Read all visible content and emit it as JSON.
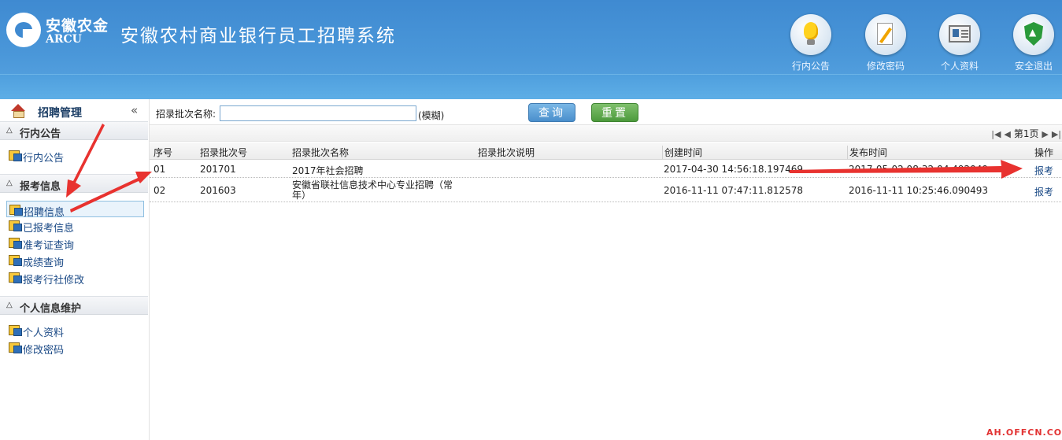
{
  "header": {
    "logo_cn": "安徽农金",
    "logo_en": "ARCU",
    "system_title": "安徽农村商业银行员工招聘系统",
    "nav": [
      {
        "label": "行内公告",
        "icon": "lightbulb-icon"
      },
      {
        "label": "修改密码",
        "icon": "notepad-pencil-icon"
      },
      {
        "label": "个人资料",
        "icon": "id-card-icon"
      },
      {
        "label": "安全退出",
        "icon": "shield-exit-icon"
      }
    ]
  },
  "sidebar": {
    "title": "招聘管理",
    "collapse_glyph": "«",
    "sections": [
      {
        "title": "行内公告",
        "items": [
          "行内公告"
        ]
      },
      {
        "title": "报考信息",
        "items": [
          "招聘信息",
          "已报考信息",
          "准考证查询",
          "成绩查询",
          "报考行社修改"
        ]
      },
      {
        "title": "个人信息维护",
        "items": [
          "个人资料",
          "修改密码"
        ]
      }
    ],
    "active_item": "招聘信息"
  },
  "search": {
    "label": "招录批次名称:",
    "value": "",
    "hint": "(模糊)",
    "query_button": "查询",
    "reset_button": "重置"
  },
  "pager": {
    "page_text": "第1页"
  },
  "table": {
    "headers": [
      "序号",
      "招录批次号",
      "招录批次名称",
      "招录批次说明",
      "创建时间",
      "发布时间",
      "操作"
    ],
    "rows": [
      [
        "01",
        "201701",
        "2017年社会招聘",
        "",
        "2017-04-30 14:56:18.197469",
        "2017-05-02 08:32:04.492049",
        "报考"
      ],
      [
        "02",
        "201603",
        "安徽省联社信息技术中心专业招聘（常年）",
        "",
        "2016-11-11 07:47:11.812578",
        "2016-11-11 10:25:46.090493",
        "报考"
      ]
    ]
  },
  "watermark": "AH.OFFCN.COM",
  "colors": {
    "header_blue": "#4a97d9",
    "query_button": "#4a8fcc",
    "reset_button": "#4c9a3c",
    "link": "#1b4a86",
    "annotation_arrow": "#e8322f"
  }
}
